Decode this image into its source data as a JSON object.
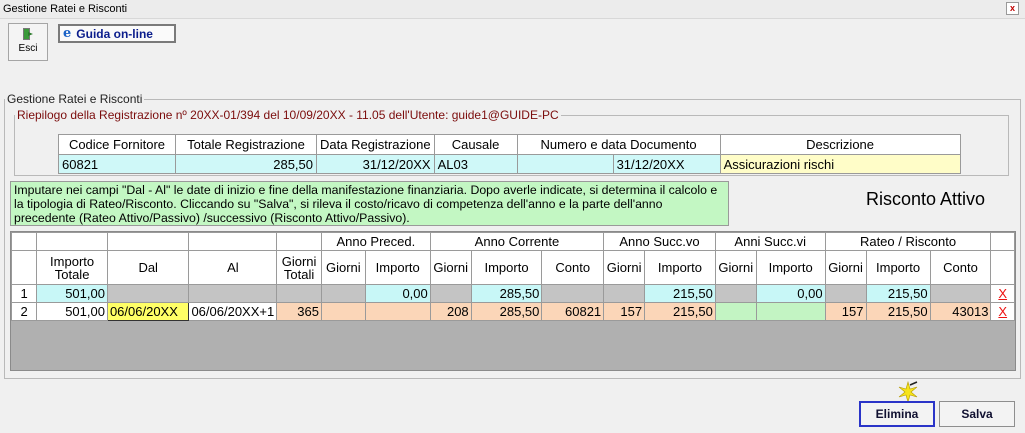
{
  "window": {
    "title": "Gestione Ratei e Risconti",
    "close_glyph": "x"
  },
  "toolbar": {
    "esci_label": "Esci",
    "guida_label": "Guida on-line",
    "guida_glyph": "e"
  },
  "group": {
    "legend": "Gestione Ratei e Risconti",
    "riepilogo_legend": "Riepilogo della Registrazione nº  20XX-01/394  del 10/09/20XX - 11.05 dell'Utente: guide1@GUIDE-PC"
  },
  "summary": {
    "headers": [
      "Codice Fornitore",
      "Totale Registrazione",
      "Data Registrazione",
      "Causale",
      "Numero e data Documento",
      "Descrizione"
    ],
    "values": {
      "codice_fornitore": "60821",
      "totale_registrazione": "285,50",
      "data_registrazione": "31/12/20XX",
      "causale": "AL03",
      "numero_documento": "",
      "data_documento": "31/12/20XX",
      "descrizione": "Assicurazioni rischi"
    }
  },
  "info_text": "Imputare nei campi \"Dal - Al\" le date di inizio e fine della manifestazione finanziaria. Dopo averle indicate, si determina il calcolo e la tipologia di Rateo/Risconto. Cliccando su \"Salva\", si rileva il costo/ricavo di competenza dell'anno e la parte dell'anno precedente (Rateo Attivo/Passivo) /successivo (Risconto Attivo/Passivo).",
  "type_label": "Risconto Attivo",
  "grid": {
    "groups": {
      "anno_preced": "Anno Preced.",
      "anno_corrente": "Anno Corrente",
      "anno_succ": "Anno Succ.vo",
      "anni_succ": "Anni Succ.vi",
      "rateo_risconto": "Rateo / Risconto"
    },
    "headers": {
      "importo_totale": "Importo Totale",
      "dal": "Dal",
      "al": "Al",
      "giorni_totali": "Giorni Totali",
      "giorni": "Giorni",
      "importo": "Importo",
      "conto": "Conto"
    },
    "rows": [
      {
        "n": "1",
        "importo_totale": "501,00",
        "dal": "",
        "al": "",
        "giorni_totali": "",
        "prec_giorni": "",
        "prec_importo": "0,00",
        "corr_giorni": "",
        "corr_importo": "285,50",
        "corr_conto": "",
        "succ_giorni": "",
        "succ_importo": "215,50",
        "anni_giorni": "",
        "anni_importo": "0,00",
        "rr_giorni": "",
        "rr_importo": "215,50",
        "rr_conto": "",
        "delete": "X"
      },
      {
        "n": "2",
        "importo_totale": "501,00",
        "dal": "06/06/20XX",
        "al": "06/06/20XX+1",
        "giorni_totali": "365",
        "prec_giorni": "",
        "prec_importo": "",
        "corr_giorni": "208",
        "corr_importo": "285,50",
        "corr_conto": "60821",
        "succ_giorni": "157",
        "succ_importo": "215,50",
        "anni_giorni": "",
        "anni_importo": "",
        "rr_giorni": "157",
        "rr_importo": "215,50",
        "rr_conto": "43013",
        "delete": "X"
      }
    ]
  },
  "buttons": {
    "elimina": "Elimina",
    "salva": "Salva"
  },
  "colors": {
    "cyan_cell": "#c8f7f7",
    "orange_cell": "#fbd6b8",
    "green_cell": "#c3f4c3",
    "gray_cell": "#c4c4c4",
    "highlight": "#ffff66",
    "info_bg": "#c3f7c3",
    "legend_dark_red": "#7b0c0c",
    "accent_blue": "#2a34c8",
    "delete_red": "#ee1111"
  }
}
